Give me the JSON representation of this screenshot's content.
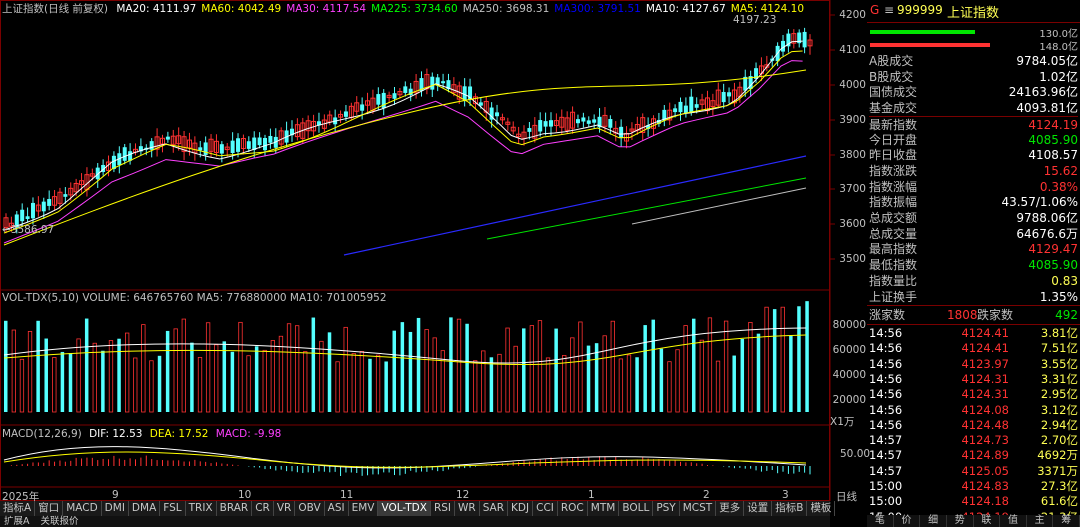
{
  "header": {
    "title": "上证指数(日线 前复权)",
    "ma": [
      {
        "label": "MA20: 4111.97",
        "color": "#ffffff"
      },
      {
        "label": "MA60: 4042.49",
        "color": "#ffff00"
      },
      {
        "label": "MA30: 4117.54",
        "color": "#ff40ff"
      },
      {
        "label": "MA225: 3734.60",
        "color": "#00ff00"
      },
      {
        "label": "MA250: 3698.31",
        "color": "#c0c0c0"
      },
      {
        "label": "MA300: 3791.51",
        "color": "#0000ff"
      },
      {
        "label": "MA10: 4127.67",
        "color": "#ffffff"
      },
      {
        "label": "MA5: 4124.10",
        "color": "#ffff00"
      }
    ],
    "high_marker": "4197.23",
    "low_marker": "3586.97"
  },
  "price_axis": [
    "4200",
    "4100",
    "4000",
    "3900",
    "3800",
    "3700",
    "3600",
    "3500"
  ],
  "volume": {
    "title": "VOL-TDX(5,10) VOLUME: 646765760 MA5: 776880000 MA10: 701005952",
    "axis": [
      "80000",
      "60000",
      "40000",
      "20000"
    ],
    "unit": "X1万"
  },
  "macd": {
    "name": "MACD(12,26,9)",
    "dif": "DIF: 12.53",
    "dea": "DEA: 17.52",
    "val": "MACD: -9.98",
    "axis": "50.00"
  },
  "date_axis": [
    "2025年",
    "9",
    "10",
    "11",
    "12",
    "1",
    "2",
    "3"
  ],
  "period_label": "日线",
  "tabs": [
    "指标A",
    "窗口",
    "MACD",
    "DMI",
    "DMA",
    "FSL",
    "TRIX",
    "BRAR",
    "CR",
    "VR",
    "OBV",
    "ASI",
    "EMV",
    "VOL-TDX",
    "RSI",
    "WR",
    "SAR",
    "KDJ",
    "CCI",
    "ROC",
    "MTM",
    "BOLL",
    "PSY",
    "MCST",
    "更多",
    "设置",
    "指标B",
    "模板"
  ],
  "bottom": [
    "扩展A",
    "关联报价"
  ],
  "right": {
    "code": "999999",
    "name": "上证指数",
    "bar1_val": "130.0亿",
    "bar2_val": "148.0亿",
    "stats": [
      {
        "k": "A股成交",
        "v": "9784.05亿",
        "c": "white"
      },
      {
        "k": "B股成交",
        "v": "1.02亿",
        "c": "white"
      },
      {
        "k": "国债成交",
        "v": "24163.96亿",
        "c": "white"
      },
      {
        "k": "基金成交",
        "v": "4093.81亿",
        "c": "white"
      },
      {
        "k": "最新指数",
        "v": "4124.19",
        "c": "red"
      },
      {
        "k": "今日开盘",
        "v": "4085.90",
        "c": "green"
      },
      {
        "k": "昨日收盘",
        "v": "4108.57",
        "c": "white"
      },
      {
        "k": "指数涨跌",
        "v": "15.62",
        "c": "red"
      },
      {
        "k": "指数涨幅",
        "v": "0.38%",
        "c": "red"
      },
      {
        "k": "指数振幅",
        "v": "43.57/1.06%",
        "c": "white"
      },
      {
        "k": "总成交额",
        "v": "9788.06亿",
        "c": "white"
      },
      {
        "k": "总成交量",
        "v": "64676.6万",
        "c": "white"
      },
      {
        "k": "最高指数",
        "v": "4129.47",
        "c": "red"
      },
      {
        "k": "最低指数",
        "v": "4085.90",
        "c": "green"
      },
      {
        "k": "指数量比",
        "v": "0.83",
        "c": "yellow"
      },
      {
        "k": "上证换手",
        "v": "1.35%",
        "c": "white"
      }
    ],
    "up_label": "涨家数",
    "up_value": "1808",
    "down_label": "跌家数",
    "down_value": "492",
    "ticks": [
      {
        "t": "14:56",
        "p": "4124.41",
        "q": "3.81亿"
      },
      {
        "t": "14:56",
        "p": "4124.41",
        "q": "7.51亿"
      },
      {
        "t": "14:56",
        "p": "4123.97",
        "q": "3.55亿"
      },
      {
        "t": "14:56",
        "p": "4124.31",
        "q": "3.31亿"
      },
      {
        "t": "14:56",
        "p": "4124.31",
        "q": "2.95亿"
      },
      {
        "t": "14:56",
        "p": "4124.08",
        "q": "3.12亿"
      },
      {
        "t": "14:56",
        "p": "4124.48",
        "q": "2.94亿"
      },
      {
        "t": "14:57",
        "p": "4124.73",
        "q": "2.70亿"
      },
      {
        "t": "14:57",
        "p": "4124.89",
        "q": "4692万"
      },
      {
        "t": "14:57",
        "p": "4125.05",
        "q": "3371万"
      },
      {
        "t": "15:00",
        "p": "4124.83",
        "q": "27.3亿"
      },
      {
        "t": "15:00",
        "p": "4124.18",
        "q": "61.6亿"
      },
      {
        "t": "15:00",
        "p": "4124.19",
        "q": "21.3亿"
      }
    ],
    "bottom_tabs": [
      "笔",
      "价",
      "细",
      "势",
      "联",
      "值",
      "主",
      "筹"
    ]
  }
}
